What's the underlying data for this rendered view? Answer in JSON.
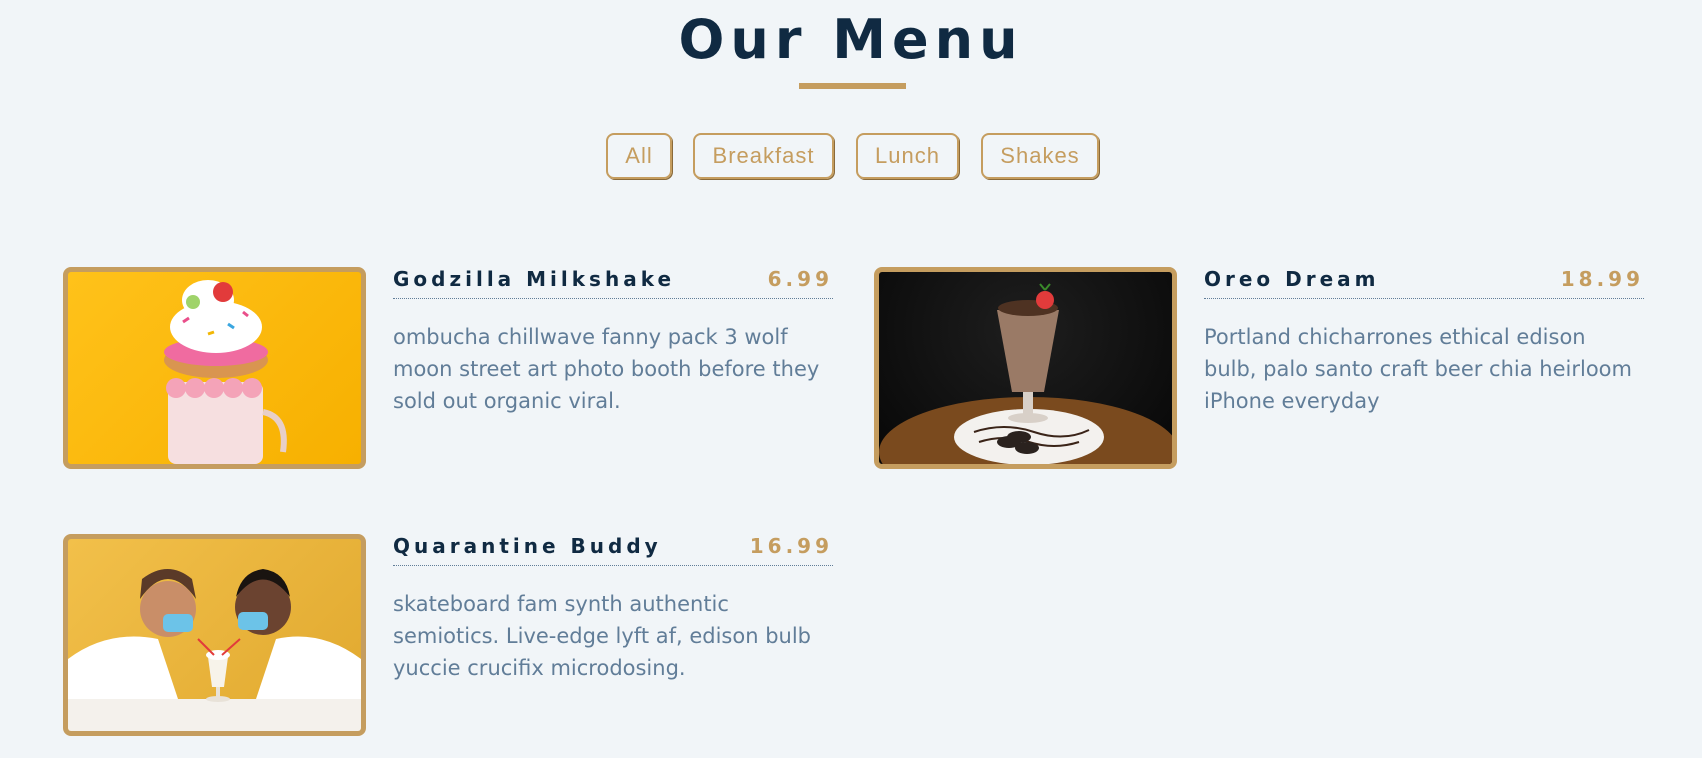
{
  "page": {
    "title": "Our Menu"
  },
  "filters": [
    "All",
    "Breakfast",
    "Lunch",
    "Shakes"
  ],
  "menu": [
    {
      "name": "Godzilla Milkshake",
      "price": "6.99",
      "desc": "ombucha chillwave fanny pack 3 wolf moon street art photo booth before they sold out organic viral.",
      "image": "milkshake-donut-photo"
    },
    {
      "name": "Oreo Dream",
      "price": "18.99",
      "desc": "Portland chicharrones ethical edison bulb, palo santo craft beer chia heirloom iPhone everyday",
      "image": "oreo-shake-photo"
    },
    {
      "name": "Quarantine Buddy",
      "price": "16.99",
      "desc": "skateboard fam synth authentic semiotics. Live-edge lyft af, edison bulb yuccie crucifix microdosing.",
      "image": "couple-sharing-shake-photo"
    }
  ],
  "colors": {
    "accent": "#c59d5f",
    "heading": "#102a42",
    "text": "#617d98",
    "background": "#f1f5f8"
  }
}
